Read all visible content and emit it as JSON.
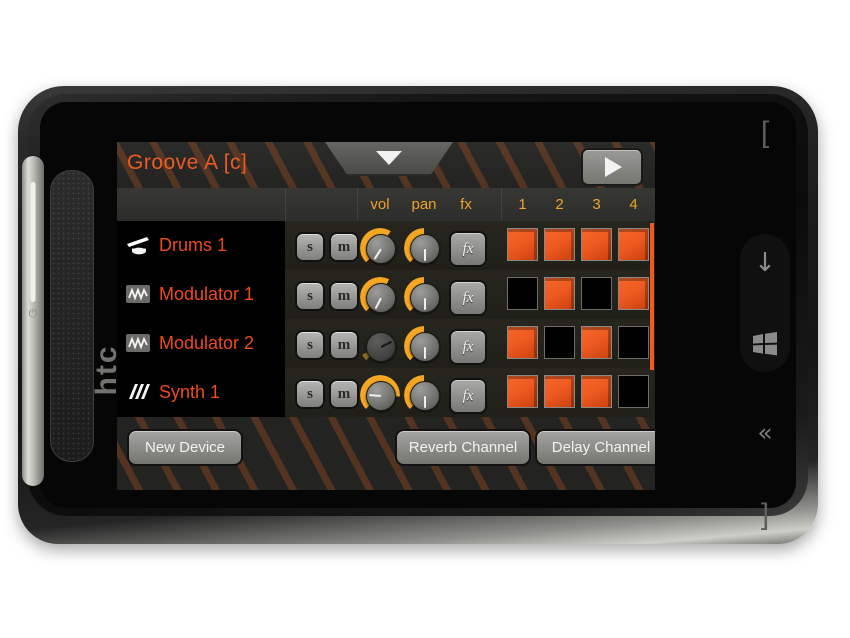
{
  "device": {
    "brand": "htc",
    "power_icon": "power-icon",
    "keys": [
      {
        "name": "search-bracket-left-key",
        "glyph": "["
      },
      {
        "name": "down-arrow-key",
        "glyph": "↓"
      },
      {
        "name": "windows-start-key",
        "glyph": "windows-logo-icon"
      },
      {
        "name": "back-key",
        "glyph": "«"
      },
      {
        "name": "bracket-right-key",
        "glyph": "]"
      }
    ]
  },
  "app": {
    "title": "Groove A [c]",
    "dropdown_icon": "chevron-down-icon",
    "play_icon": "play-icon",
    "accent": "#ef5a21",
    "header_label_color": "#f0a32a",
    "columns": [
      "vol",
      "pan",
      "fx",
      "1",
      "2",
      "3",
      "4"
    ],
    "solo_label": "s",
    "mute_label": "m",
    "fx_label": "fx",
    "tracks": [
      {
        "name": "Drums 1",
        "icon": "cymbal-icon",
        "vol": 0.62,
        "pan": 0.5,
        "muted": false,
        "steps": [
          true,
          true,
          true,
          true
        ]
      },
      {
        "name": "Modulator 1",
        "icon": "waveform-icon",
        "vol": 0.6,
        "pan": 0.5,
        "muted": false,
        "steps": [
          false,
          true,
          false,
          true
        ]
      },
      {
        "name": "Modulator 2",
        "icon": "waveform-icon",
        "vol": 0.07,
        "pan": 0.5,
        "muted": true,
        "steps": [
          true,
          false,
          true,
          false
        ]
      },
      {
        "name": "Synth 1",
        "icon": "synth-bars-icon",
        "vol": 0.85,
        "pan": 0.5,
        "muted": false,
        "steps": [
          true,
          true,
          true,
          false
        ]
      }
    ],
    "footer": {
      "new_device": "New Device",
      "reverb_channel": "Reverb Channel",
      "delay_channel": "Delay Channel"
    }
  }
}
